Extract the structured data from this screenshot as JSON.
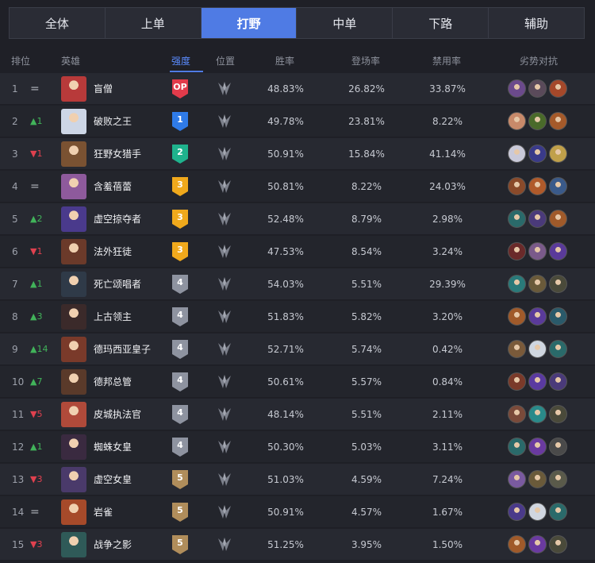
{
  "tabs": [
    {
      "label": "全体"
    },
    {
      "label": "上单"
    },
    {
      "label": "打野",
      "active": true
    },
    {
      "label": "中单"
    },
    {
      "label": "下路"
    },
    {
      "label": "辅助"
    }
  ],
  "headers": {
    "rank": "排位",
    "hero": "英雄",
    "tier": "强度",
    "position": "位置",
    "winrate": "胜率",
    "pickrate": "登场率",
    "banrate": "禁用率",
    "counters": "劣势对抗"
  },
  "colors": {
    "accent": "#4f7be4",
    "up": "#41b35a",
    "down": "#e0414f",
    "tier_op": "#e23b4b",
    "tier_1": "#2f7be8",
    "tier_2": "#1fb38d",
    "tier_3": "#f0a91c",
    "tier_4": "#8e93a0",
    "tier_5": "#b08d5b"
  },
  "rows": [
    {
      "rank": "1",
      "trend": "=",
      "trend_dir": "same",
      "name": "盲僧",
      "tier": "OP",
      "winrate": "48.83%",
      "pickrate": "26.82%",
      "banrate": "33.87%"
    },
    {
      "rank": "2",
      "trend": "▲1",
      "trend_dir": "up",
      "name": "破败之王",
      "tier": "1",
      "winrate": "49.78%",
      "pickrate": "23.81%",
      "banrate": "8.22%"
    },
    {
      "rank": "3",
      "trend": "▼1",
      "trend_dir": "down",
      "name": "狂野女猎手",
      "tier": "2",
      "winrate": "50.91%",
      "pickrate": "15.84%",
      "banrate": "41.14%"
    },
    {
      "rank": "4",
      "trend": "=",
      "trend_dir": "same",
      "name": "含羞蓓蕾",
      "tier": "3",
      "winrate": "50.81%",
      "pickrate": "8.22%",
      "banrate": "24.03%"
    },
    {
      "rank": "5",
      "trend": "▲2",
      "trend_dir": "up",
      "name": "虚空掠夺者",
      "tier": "3",
      "winrate": "52.48%",
      "pickrate": "8.79%",
      "banrate": "2.98%"
    },
    {
      "rank": "6",
      "trend": "▼1",
      "trend_dir": "down",
      "name": "法外狂徒",
      "tier": "3",
      "winrate": "47.53%",
      "pickrate": "8.54%",
      "banrate": "3.24%"
    },
    {
      "rank": "7",
      "trend": "▲1",
      "trend_dir": "up",
      "name": "死亡颂唱者",
      "tier": "4",
      "winrate": "54.03%",
      "pickrate": "5.51%",
      "banrate": "29.39%"
    },
    {
      "rank": "8",
      "trend": "▲3",
      "trend_dir": "up",
      "name": "上古领主",
      "tier": "4",
      "winrate": "51.83%",
      "pickrate": "5.82%",
      "banrate": "3.20%"
    },
    {
      "rank": "9",
      "trend": "▲14",
      "trend_dir": "up",
      "name": "德玛西亚皇子",
      "tier": "4",
      "winrate": "52.71%",
      "pickrate": "5.74%",
      "banrate": "0.42%"
    },
    {
      "rank": "10",
      "trend": "▲7",
      "trend_dir": "up",
      "name": "德邦总管",
      "tier": "4",
      "winrate": "50.61%",
      "pickrate": "5.57%",
      "banrate": "0.84%"
    },
    {
      "rank": "11",
      "trend": "▼5",
      "trend_dir": "down",
      "name": "皮城执法官",
      "tier": "4",
      "winrate": "48.14%",
      "pickrate": "5.51%",
      "banrate": "2.11%"
    },
    {
      "rank": "12",
      "trend": "▲1",
      "trend_dir": "up",
      "name": "蜘蛛女皇",
      "tier": "4",
      "winrate": "50.30%",
      "pickrate": "5.03%",
      "banrate": "3.11%"
    },
    {
      "rank": "13",
      "trend": "▼3",
      "trend_dir": "down",
      "name": "虚空女皇",
      "tier": "5",
      "winrate": "51.03%",
      "pickrate": "4.59%",
      "banrate": "7.24%"
    },
    {
      "rank": "14",
      "trend": "=",
      "trend_dir": "same",
      "name": "岩雀",
      "tier": "5",
      "winrate": "50.91%",
      "pickrate": "4.57%",
      "banrate": "1.67%"
    },
    {
      "rank": "15",
      "trend": "▼3",
      "trend_dir": "down",
      "name": "战争之影",
      "tier": "5",
      "winrate": "51.25%",
      "pickrate": "3.95%",
      "banrate": "1.50%"
    }
  ],
  "portrait_colors": [
    "#b83a3a",
    "#cdd6e6",
    "#7a5232",
    "#8e5a9c",
    "#4a3a8c",
    "#6b3a2a",
    "#2f3a48",
    "#3b2a2a",
    "#7a3a2a",
    "#5a3a2a",
    "#b04a3a",
    "#3a2a40",
    "#4a3a6a",
    "#a64a2a",
    "#2f5a58"
  ],
  "counter_colors": [
    [
      "#6b4a8c",
      "#5a4a5a",
      "#a5482a"
    ],
    [
      "#c88a6a",
      "#4a6a2a",
      "#a55a2a"
    ],
    [
      "#c9c9d9",
      "#3a3a8a",
      "#c0a04a"
    ],
    [
      "#8a4a2a",
      "#b05a2a",
      "#3a5a8a"
    ],
    [
      "#2a6a6a",
      "#4a3a7a",
      "#a05a2a"
    ],
    [
      "#6a2a2a",
      "#7a5a8a",
      "#5a3a9a"
    ],
    [
      "#2a7a7a",
      "#6a5a3a",
      "#4a4a3a"
    ],
    [
      "#a05a2a",
      "#5a3a9a",
      "#2a5a6a"
    ],
    [
      "#7a5a3a",
      "#cfd6e0",
      "#2a6a6a"
    ],
    [
      "#7a3a2a",
      "#5a3aa0",
      "#4a3a7a"
    ],
    [
      "#7a4a3a",
      "#2a8a8a",
      "#4a4a3a"
    ],
    [
      "#2a6a6a",
      "#6a3aa0",
      "#4a4a4a"
    ],
    [
      "#7a5aa0",
      "#6a5a3a",
      "#5a5a4a"
    ],
    [
      "#4a3a8a",
      "#d0d6e0",
      "#2a6a6a"
    ],
    [
      "#a05a2a",
      "#6a3aa0",
      "#4a4a3a"
    ]
  ]
}
